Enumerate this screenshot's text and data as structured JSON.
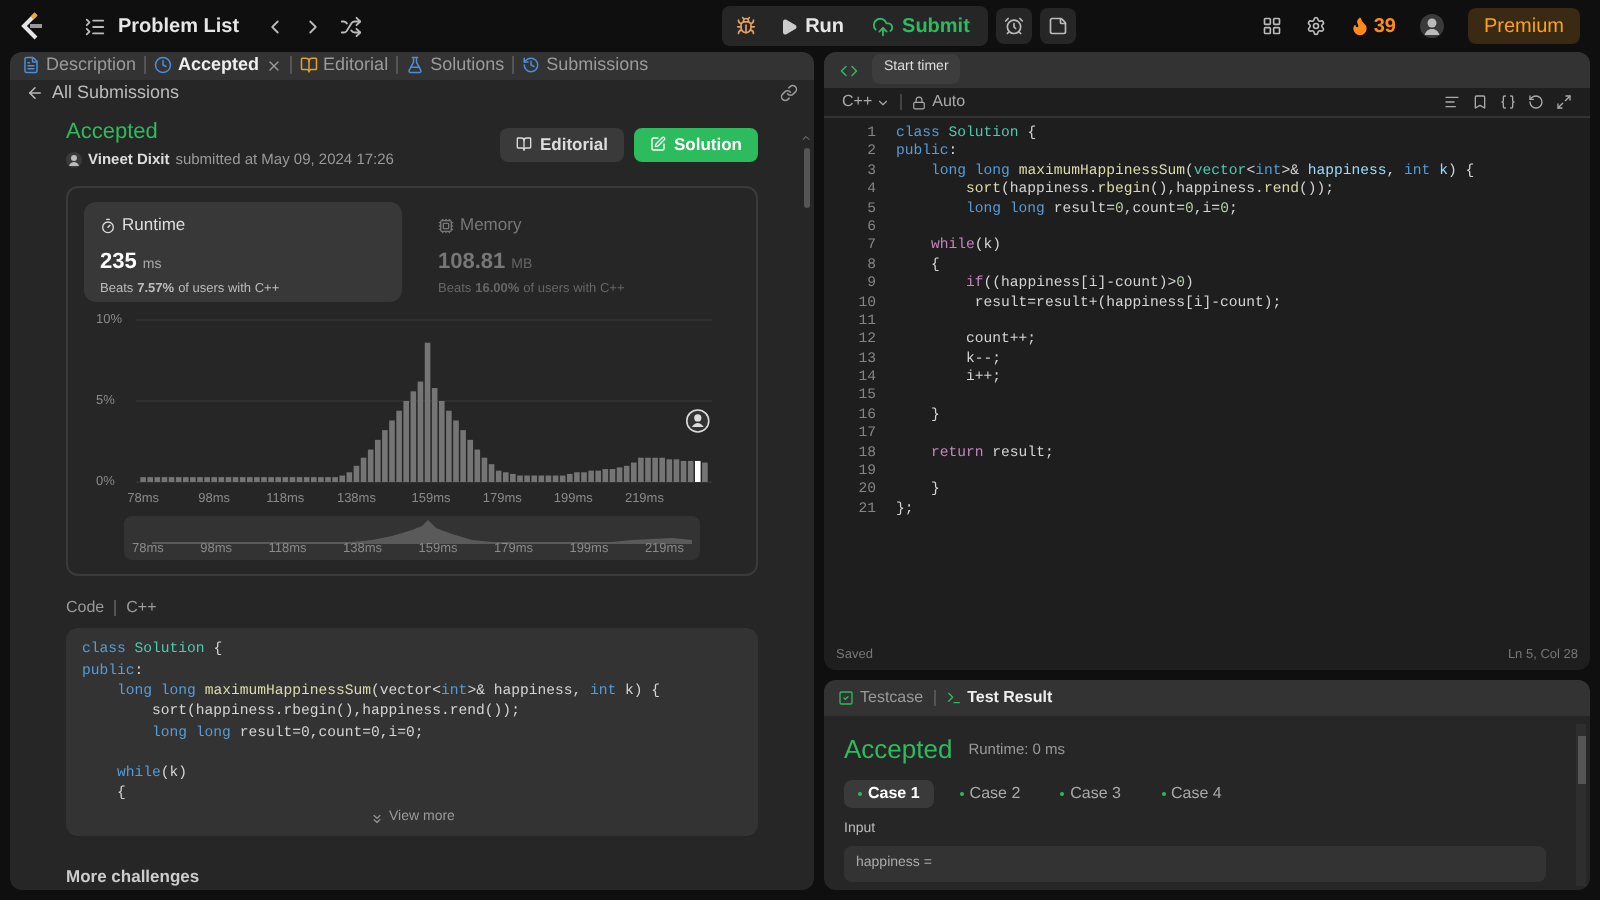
{
  "top_bar": {
    "title": "Problem List",
    "run": "Run",
    "submit": "Submit",
    "streak": "39",
    "premium": "Premium"
  },
  "left_panel": {
    "tabs": [
      {
        "label": "Description",
        "selected": false,
        "closable": false
      },
      {
        "label": "Accepted",
        "selected": true,
        "closable": true
      },
      {
        "label": "Editorial",
        "selected": false,
        "closable": false
      },
      {
        "label": "Solutions",
        "selected": false,
        "closable": false
      },
      {
        "label": "Submissions",
        "selected": false,
        "closable": false
      }
    ],
    "back_link": "All Submissions",
    "status": "Accepted",
    "author": "Vineet Dixit",
    "submitted": "submitted at May 09, 2024 17:26",
    "buttons": [
      {
        "label": "Editorial",
        "kind": "secondary"
      },
      {
        "label": "Solution",
        "kind": "primary"
      }
    ],
    "stats": [
      {
        "title": "Runtime",
        "value": "235",
        "unit": "ms",
        "beats": "Beats",
        "percent": "7.57%",
        "suffix": "of users with C++",
        "selected": true
      },
      {
        "title": "Memory",
        "value": "108.81",
        "unit": "MB",
        "beats": "Beats",
        "percent": "16.00%",
        "suffix": "of users with C++",
        "selected": false
      }
    ],
    "chart_data": {
      "type": "bar",
      "x": [
        78,
        80,
        82,
        84,
        86,
        88,
        90,
        92,
        94,
        96,
        98,
        100,
        102,
        104,
        106,
        108,
        110,
        112,
        114,
        116,
        118,
        120,
        122,
        124,
        126,
        128,
        130,
        132,
        134,
        136,
        138,
        140,
        142,
        144,
        146,
        148,
        150,
        152,
        154,
        156,
        158,
        160,
        162,
        164,
        166,
        168,
        170,
        172,
        174,
        176,
        178,
        180,
        182,
        184,
        186,
        188,
        190,
        192,
        194,
        196,
        198,
        200,
        202,
        204,
        206,
        208,
        210,
        212,
        214,
        216,
        218,
        220,
        222,
        224,
        226,
        228,
        230,
        232,
        234,
        236
      ],
      "values": [
        0.3,
        0.3,
        0.3,
        0.3,
        0.3,
        0.3,
        0.3,
        0.3,
        0.3,
        0.3,
        0.3,
        0.3,
        0.3,
        0.3,
        0.3,
        0.3,
        0.3,
        0.3,
        0.3,
        0.3,
        0.3,
        0.3,
        0.3,
        0.3,
        0.3,
        0.3,
        0.3,
        0.3,
        0.4,
        0.6,
        1.0,
        1.5,
        2.0,
        2.6,
        3.2,
        3.8,
        4.4,
        5.0,
        5.6,
        6.2,
        8.6,
        5.8,
        5.0,
        4.4,
        3.8,
        3.2,
        2.6,
        2.0,
        1.5,
        1.1,
        0.7,
        0.6,
        0.5,
        0.4,
        0.4,
        0.4,
        0.4,
        0.4,
        0.4,
        0.4,
        0.5,
        0.6,
        0.6,
        0.7,
        0.7,
        0.8,
        0.8,
        0.9,
        1.0,
        1.2,
        1.5,
        1.5,
        1.5,
        1.5,
        1.4,
        1.4,
        1.3,
        1.3,
        1.3,
        1.2
      ],
      "xlim": [
        76,
        238
      ],
      "ylim": [
        0,
        10
      ],
      "yticks": [
        {
          "value": 0,
          "label": "0%"
        },
        {
          "value": 5,
          "label": "5%"
        },
        {
          "value": 10,
          "label": "10%"
        }
      ],
      "xticks": [
        {
          "value": 78,
          "label": "78ms"
        },
        {
          "value": 98,
          "label": "98ms"
        },
        {
          "value": 118,
          "label": "118ms"
        },
        {
          "value": 138,
          "label": "138ms"
        },
        {
          "value": 159,
          "label": "159ms"
        },
        {
          "value": 179,
          "label": "179ms"
        },
        {
          "value": 199,
          "label": "199ms"
        },
        {
          "value": 219,
          "label": "219ms"
        }
      ]
    },
    "navigator_labels": [
      "78ms",
      "98ms",
      "118ms",
      "138ms",
      "159ms",
      "179ms",
      "199ms",
      "219ms"
    ],
    "code_header": {
      "label": "Code",
      "language": "C++"
    },
    "code_preview": [
      {
        "kind": "code",
        "segs": [
          {
            "text": "class ",
            "kind": "kw"
          },
          {
            "text": "Solution",
            "kind": "type"
          },
          {
            "text": " {",
            "kind": "p"
          }
        ]
      },
      {
        "kind": "code",
        "segs": [
          {
            "text": "public",
            "kind": "kw"
          },
          {
            "text": ":",
            "kind": "p"
          }
        ]
      },
      {
        "kind": "code",
        "segs": [
          {
            "text": "    long long ",
            "kind": "kw"
          },
          {
            "text": "maximumHappinessSum",
            "kind": "fn"
          },
          {
            "text": "(vector<",
            "kind": "p"
          },
          {
            "text": "int",
            "kind": "kw"
          },
          {
            "text": ">& happiness, ",
            "kind": "p"
          },
          {
            "text": "int",
            "kind": "kw"
          },
          {
            "text": " k) {",
            "kind": "p"
          }
        ]
      },
      {
        "kind": "code",
        "segs": [
          {
            "text": "        sort(happiness.rbegin(),happiness.rend());",
            "kind": "p"
          }
        ]
      },
      {
        "kind": "code",
        "segs": [
          {
            "text": "        long long",
            "kind": "kw"
          },
          {
            "text": " result=0,count=0,i=0;",
            "kind": "p"
          }
        ]
      },
      {
        "kind": "blank"
      },
      {
        "kind": "code",
        "segs": [
          {
            "text": "    while",
            "kind": "kw"
          },
          {
            "text": "(k)",
            "kind": "p"
          }
        ]
      },
      {
        "kind": "code",
        "segs": [
          {
            "text": "    {",
            "kind": "p"
          }
        ]
      }
    ],
    "view_more": "View more",
    "more_challenges": "More challenges"
  },
  "editor": {
    "tooltip": "Start timer",
    "language": "C++",
    "mode": "Auto",
    "saved": "Saved",
    "cursor": "Ln 5, Col 28",
    "lines": [
      {
        "n": "1",
        "segs": [
          {
            "text": "class ",
            "kind": "kw"
          },
          {
            "text": "Solution",
            "kind": "type"
          },
          {
            "text": " {",
            "kind": "p"
          }
        ]
      },
      {
        "n": "2",
        "segs": [
          {
            "text": "public",
            "kind": "kw"
          },
          {
            "text": ":",
            "kind": "p"
          }
        ]
      },
      {
        "n": "3",
        "segs": [
          {
            "text": "    long long ",
            "kind": "kw"
          },
          {
            "text": "maximumHappinessSum",
            "kind": "fn"
          },
          {
            "text": "(",
            "kind": "p"
          },
          {
            "text": "vector",
            "kind": "type"
          },
          {
            "text": "<",
            "kind": "p"
          },
          {
            "text": "int",
            "kind": "kw"
          },
          {
            "text": ">& ",
            "kind": "p"
          },
          {
            "text": "happiness",
            "kind": "var"
          },
          {
            "text": ", ",
            "kind": "p"
          },
          {
            "text": "int ",
            "kind": "kw"
          },
          {
            "text": "k",
            "kind": "var"
          },
          {
            "text": ") {",
            "kind": "p"
          }
        ]
      },
      {
        "n": "4",
        "segs": [
          {
            "text": "        sort",
            "kind": "fn"
          },
          {
            "text": "(happiness.",
            "kind": "p"
          },
          {
            "text": "rbegin",
            "kind": "fn"
          },
          {
            "text": "(),happiness.",
            "kind": "p"
          },
          {
            "text": "rend",
            "kind": "fn"
          },
          {
            "text": "());",
            "kind": "p"
          }
        ]
      },
      {
        "n": "5",
        "segs": [
          {
            "text": "        long long ",
            "kind": "kw"
          },
          {
            "text": "result=",
            "kind": "p"
          },
          {
            "text": "0",
            "kind": "num"
          },
          {
            "text": ",count=",
            "kind": "p"
          },
          {
            "text": "0",
            "kind": "num"
          },
          {
            "text": ",i=",
            "kind": "p"
          },
          {
            "text": "0",
            "kind": "num"
          },
          {
            "text": ";",
            "kind": "p"
          }
        ]
      },
      {
        "n": "6"
      },
      {
        "n": "7",
        "segs": [
          {
            "text": "    while",
            "kind": "ctrl"
          },
          {
            "text": "(k)",
            "kind": "p"
          }
        ]
      },
      {
        "n": "8",
        "segs": [
          {
            "text": "    {",
            "kind": "p"
          }
        ]
      },
      {
        "n": "9",
        "segs": [
          {
            "text": "        if",
            "kind": "ctrl"
          },
          {
            "text": "((happiness[i]-count)>",
            "kind": "p"
          },
          {
            "text": "0",
            "kind": "num"
          },
          {
            "text": ")",
            "kind": "p"
          }
        ]
      },
      {
        "n": "10",
        "segs": [
          {
            "text": "         result=result+(happiness[i]-count);",
            "kind": "p"
          }
        ]
      },
      {
        "n": "11"
      },
      {
        "n": "12",
        "segs": [
          {
            "text": "        count++;",
            "kind": "p"
          }
        ]
      },
      {
        "n": "13",
        "segs": [
          {
            "text": "        k--;",
            "kind": "p"
          }
        ]
      },
      {
        "n": "14",
        "segs": [
          {
            "text": "        i++;",
            "kind": "p"
          }
        ]
      },
      {
        "n": "15"
      },
      {
        "n": "16",
        "segs": [
          {
            "text": "    }",
            "kind": "p"
          }
        ]
      },
      {
        "n": "17"
      },
      {
        "n": "18",
        "segs": [
          {
            "text": "    return",
            "kind": "ctrl"
          },
          {
            "text": " result;",
            "kind": "p"
          }
        ]
      },
      {
        "n": "19"
      },
      {
        "n": "20",
        "segs": [
          {
            "text": "    }",
            "kind": "p"
          }
        ]
      },
      {
        "n": "21",
        "segs": [
          {
            "text": "};",
            "kind": "p"
          }
        ]
      }
    ]
  },
  "result_panel": {
    "tabs": [
      {
        "label": "Testcase",
        "selected": false
      },
      {
        "label": "Test Result",
        "selected": true
      }
    ],
    "status": "Accepted",
    "runtime": "Runtime: 0 ms",
    "cases": [
      {
        "label": "Case 1",
        "selected": true
      },
      {
        "label": "Case 2",
        "selected": false
      },
      {
        "label": "Case 3",
        "selected": false
      },
      {
        "label": "Case 4",
        "selected": false
      }
    ],
    "input_label": "Input",
    "input_value": "happiness ="
  }
}
